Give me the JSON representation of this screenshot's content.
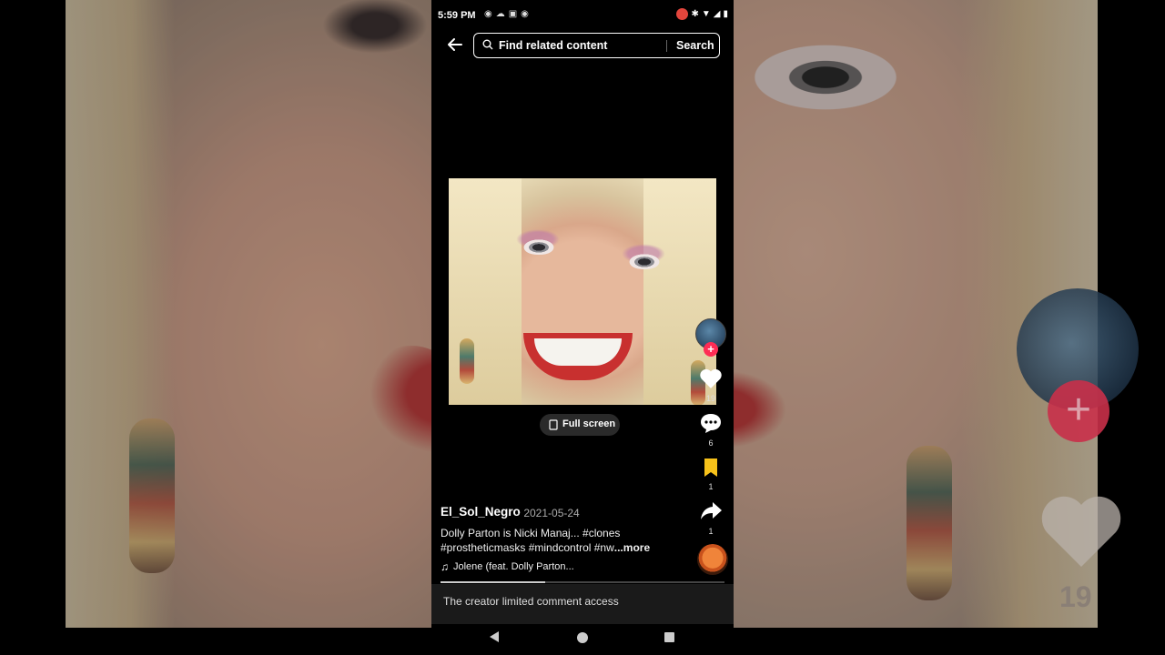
{
  "status_bar": {
    "time": "5:59 PM"
  },
  "header": {
    "search_placeholder": "Find related content",
    "search_button": "Search"
  },
  "video": {
    "fullscreen_label": "Full screen",
    "progress_fraction": 0.37
  },
  "actions": {
    "likes": "19",
    "comments": "6",
    "saves": "1",
    "shares": "1"
  },
  "post": {
    "username": "El_Sol_Negro",
    "date": "· 2021-05-24",
    "caption_line1": "Dolly Parton is Nicki Manaj... #clones",
    "caption_line2": "#prostheticmasks #mindcontrol #nw",
    "caption_more": "...more",
    "music": "Jolene (feat. Dolly Parton..."
  },
  "comment_bar": {
    "text": "The creator limited comment access"
  },
  "background_overlay": {
    "likes": "19"
  },
  "colors": {
    "accent": "#fe2c55",
    "save_yellow": "#f7c21a"
  }
}
